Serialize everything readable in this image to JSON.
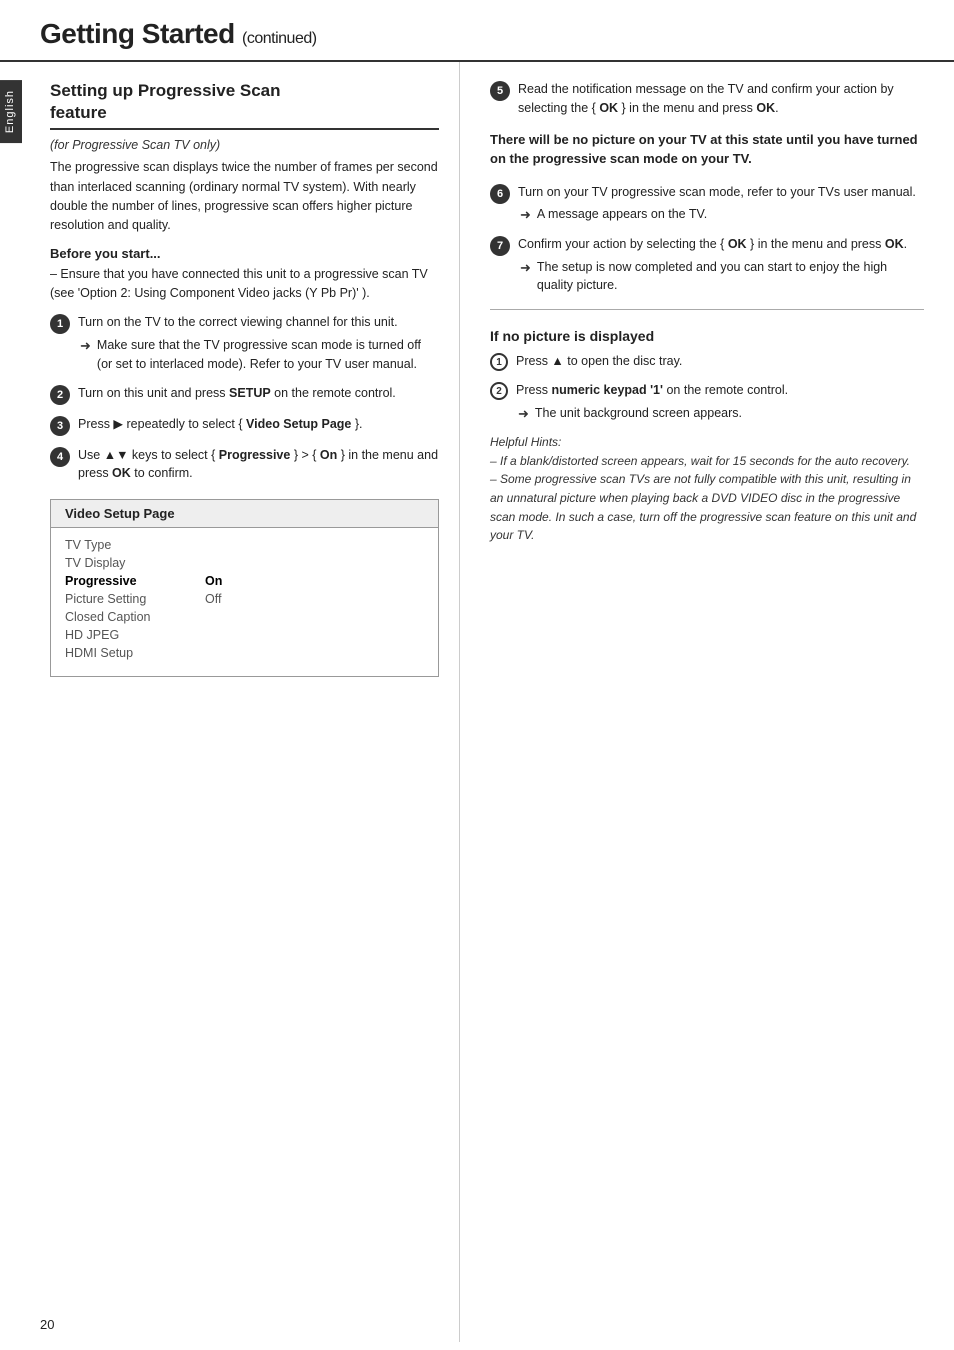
{
  "header": {
    "title": "Getting Started",
    "continued": "(continued)"
  },
  "lang_tab": "English",
  "section": {
    "title_line1": "Setting up Progressive Scan",
    "title_line2": "feature",
    "italic_note": "(for Progressive Scan TV only)",
    "intro_text": "The progressive scan displays twice the number of frames per second than interlaced scanning (ordinary normal TV system). With nearly double the number of lines, progressive scan offers higher picture resolution and quality.",
    "before_start_label": "Before you start...",
    "before_start_text": "–  Ensure that you have connected this unit to a progressive scan TV (see 'Option 2: Using Component Video jacks (Y Pb Pr)' ).",
    "steps_left": [
      {
        "num": "1",
        "text": "Turn on the TV to the correct viewing channel for this unit.",
        "arrow": "Make sure that the TV progressive scan mode is turned off (or set to interlaced mode). Refer to your TV user manual."
      },
      {
        "num": "2",
        "text": "Turn on this unit and press SETUP on the remote control.",
        "arrow": null
      },
      {
        "num": "3",
        "text": "Press ▶ repeatedly to select { Video Setup Page }.",
        "arrow": null
      },
      {
        "num": "4",
        "text": "Use ▲▼ keys to select { Progressive } > { On } in the menu and press OK to confirm.",
        "arrow": null
      }
    ],
    "setup_table": {
      "header": "Video Setup Page",
      "rows": [
        {
          "label": "TV Type",
          "value": "",
          "active": false
        },
        {
          "label": "TV Display",
          "value": "",
          "active": false
        },
        {
          "label": "Progressive",
          "value": "On",
          "active": true
        },
        {
          "label": "Picture Setting",
          "value": "Off",
          "active": false
        },
        {
          "label": "Closed Caption",
          "value": "",
          "active": false
        },
        {
          "label": "HD JPEG",
          "value": "",
          "active": false
        },
        {
          "label": "HDMI Setup",
          "value": "",
          "active": false
        }
      ]
    },
    "steps_right": [
      {
        "num": "5",
        "text": "Read the notification message on the TV and confirm your action by selecting the { OK } in the menu and press OK.",
        "arrow": null
      },
      {
        "num": "6",
        "text": "Turn on your TV progressive scan mode, refer to your TVs user manual.",
        "arrow": "A message appears on the TV."
      },
      {
        "num": "7",
        "text": "Confirm your action by selecting the { OK } in the menu and press OK.",
        "arrow": "The setup is now completed and you can start to enjoy the high quality picture."
      }
    ],
    "warning_text": "There will be no picture on your TV at this state until you have turned on the progressive scan mode on your TV.",
    "if_no_picture_title": "If no picture is displayed",
    "no_picture_steps": [
      {
        "num": "1",
        "text": "Press ▲ to open the disc tray.",
        "arrow": null
      },
      {
        "num": "2",
        "text": "Press numeric keypad '1' on the remote control.",
        "arrow": "The unit background screen appears."
      }
    ],
    "helpful_hints_label": "Helpful Hints:",
    "helpful_hint_1": "–  If a blank/distorted screen appears, wait for 15 seconds for the auto recovery.",
    "helpful_hint_2": "–  Some progressive scan TVs are not fully compatible with this unit, resulting in an unnatural picture when playing back a DVD VIDEO disc in the progressive scan mode. In such a case, turn off the progressive scan feature on this unit and your TV."
  },
  "page_number": "20"
}
